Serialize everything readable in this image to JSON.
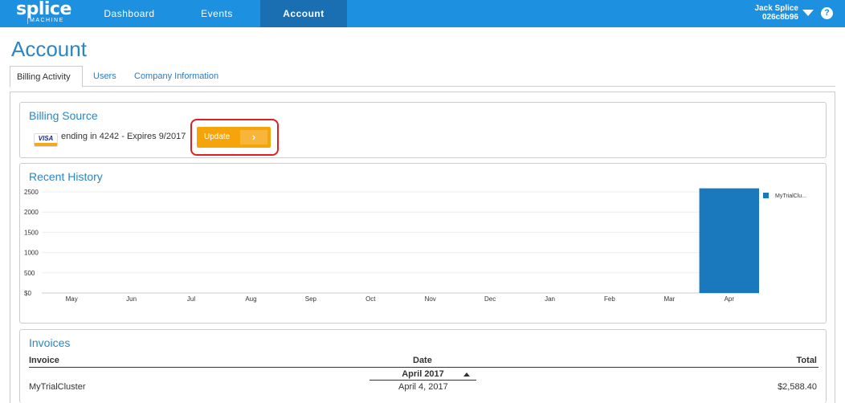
{
  "app": {
    "logo_main": "splice",
    "logo_sub": "MACHINE"
  },
  "nav": {
    "items": [
      {
        "label": "Dashboard",
        "active": false
      },
      {
        "label": "Events",
        "active": false
      },
      {
        "label": "Account",
        "active": true
      }
    ]
  },
  "user": {
    "name": "Jack Splice",
    "id": "026c8b96",
    "menu_icon": "caret-down-icon",
    "help_icon": "question-circle-icon",
    "help_glyph": "?"
  },
  "page": {
    "title": "Account"
  },
  "tabs": [
    {
      "label": "Billing Activity",
      "active": true
    },
    {
      "label": "Users",
      "active": false
    },
    {
      "label": "Company Information",
      "active": false
    }
  ],
  "billing": {
    "title": "Billing Source",
    "card_brand": "VISA",
    "card_text": "ending in 4242 - Expires 9/2017",
    "update_label": "Update",
    "update_icon": "chevron-right-icon",
    "update_glyph": "›"
  },
  "history": {
    "title": "Recent History"
  },
  "chart_data": {
    "type": "bar",
    "categories": [
      "May",
      "Jun",
      "Jul",
      "Aug",
      "Sep",
      "Oct",
      "Nov",
      "Dec",
      "Jan",
      "Feb",
      "Mar",
      "Apr"
    ],
    "series": [
      {
        "name": "MyTrialClu...",
        "color": "#1a78bd",
        "values": [
          0,
          0,
          0,
          0,
          0,
          0,
          0,
          0,
          0,
          0,
          0,
          2588.4
        ]
      }
    ],
    "yticks": [
      "$0",
      "500",
      "1000",
      "1500",
      "2000",
      "2500"
    ],
    "ytick_values": [
      0,
      500,
      1000,
      1500,
      2000,
      2500
    ],
    "ylim": [
      0,
      2600
    ],
    "grid": true,
    "legend_position": "top-right",
    "title": "",
    "xlabel": "",
    "ylabel": ""
  },
  "invoices": {
    "title": "Invoices",
    "headers": {
      "invoice": "Invoice",
      "date": "Date",
      "total": "Total"
    },
    "group_label": "April 2017",
    "rows": [
      {
        "invoice": "MyTrialCluster",
        "date": "April 4, 2017",
        "total": "$2,588.40"
      }
    ]
  },
  "colors": {
    "topbar": "#1e90e0",
    "nav_active": "#1a6fb3",
    "title_blue": "#2b86c5",
    "update_button": "#f5a40a",
    "highlight_border": "#e02020",
    "bar": "#1a78bd"
  }
}
